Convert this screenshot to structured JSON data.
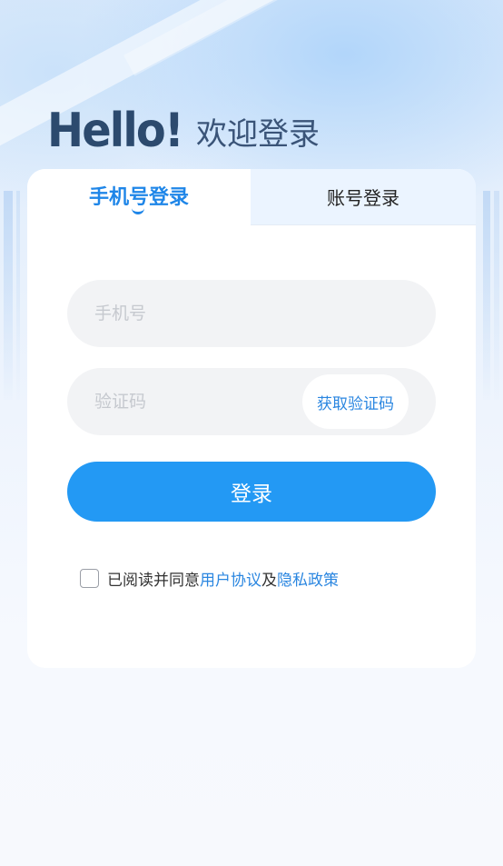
{
  "header": {
    "hello": "Hello!",
    "welcome": "欢迎登录"
  },
  "tabs": {
    "phone_login": "手机号登录",
    "account_login": "账号登录",
    "active": "phone_login"
  },
  "form": {
    "phone_placeholder": "手机号",
    "code_placeholder": "验证码",
    "get_code_label": "获取验证码",
    "login_label": "登录"
  },
  "agreement": {
    "checked": false,
    "prefix": "已阅读并同意",
    "user_agreement": "用户协议",
    "and": "及",
    "privacy_policy": "隐私政策"
  },
  "colors": {
    "accent": "#2399f4",
    "link": "#2a86e0",
    "title": "#2c4a6e"
  }
}
